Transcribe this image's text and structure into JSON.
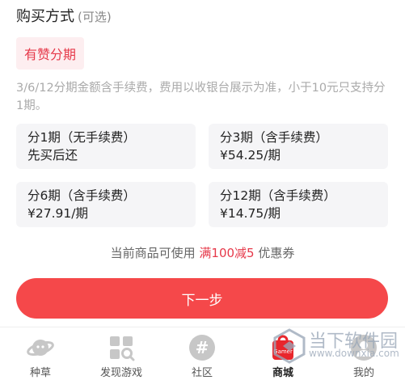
{
  "purchase": {
    "title": "购买方式",
    "optional": "(可选)",
    "chip_label": "有赞分期",
    "note": "3/6/12分期金额含手续费，费用以收银台展示为准，小于10元只支持分1期。",
    "options": [
      {
        "title": "分1期（无手续费）",
        "detail": "先买后还"
      },
      {
        "title": "分3期（含手续费）",
        "detail": "¥54.25/期"
      },
      {
        "title": "分6期（含手续费）",
        "detail": "¥27.91/期"
      },
      {
        "title": "分12期（含手续费）",
        "detail": "¥14.75/期"
      }
    ],
    "coupon_prefix": "当前商品可使用 ",
    "coupon_highlight": "满100减5",
    "coupon_suffix": " 优惠券",
    "next_label": "下一步"
  },
  "tabbar": {
    "items": [
      {
        "label": "种草",
        "icon": "planet-icon"
      },
      {
        "label": "发现游戏",
        "icon": "grid-search-icon"
      },
      {
        "label": "社区",
        "icon": "hash-icon"
      },
      {
        "label": "商城",
        "icon": "mall-icon",
        "badge": "Gamer"
      },
      {
        "label": "我的",
        "icon": "profile-icon"
      }
    ]
  },
  "watermark": {
    "text": "当下软件园",
    "url": "www.downxia.com"
  },
  "colors": {
    "accent": "#f5484a",
    "chip_bg": "#fdeef0",
    "option_bg": "#f5f5f7"
  }
}
